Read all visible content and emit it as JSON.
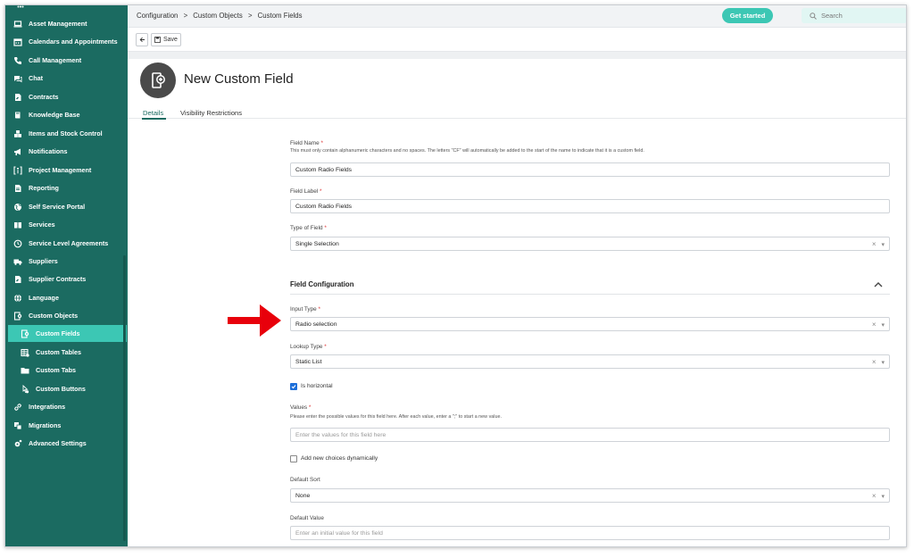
{
  "sidebar": {
    "items": [
      {
        "label": "Asset Management",
        "icon": "laptop-icon"
      },
      {
        "label": "Calendars and Appointments",
        "icon": "calendar-icon"
      },
      {
        "label": "Call Management",
        "icon": "phone-icon"
      },
      {
        "label": "Chat",
        "icon": "chat-icon"
      },
      {
        "label": "Contracts",
        "icon": "contract-icon"
      },
      {
        "label": "Knowledge Base",
        "icon": "book-icon"
      },
      {
        "label": "Items and Stock Control",
        "icon": "boxes-icon"
      },
      {
        "label": "Notifications",
        "icon": "megaphone-icon"
      },
      {
        "label": "Project Management",
        "icon": "project-icon"
      },
      {
        "label": "Reporting",
        "icon": "report-icon"
      },
      {
        "label": "Self Service Portal",
        "icon": "globe-icon"
      },
      {
        "label": "Services",
        "icon": "services-icon"
      },
      {
        "label": "Service Level Agreements",
        "icon": "clock-icon"
      },
      {
        "label": "Suppliers",
        "icon": "truck-icon"
      },
      {
        "label": "Supplier Contracts",
        "icon": "contract-icon"
      },
      {
        "label": "Language",
        "icon": "language-icon"
      },
      {
        "label": "Custom Objects",
        "icon": "custom-objects-icon"
      },
      {
        "label": "Custom Fields",
        "icon": "custom-field-icon",
        "active": true
      },
      {
        "label": "Custom Tables",
        "icon": "table-icon"
      },
      {
        "label": "Custom Tabs",
        "icon": "folder-icon"
      },
      {
        "label": "Custom Buttons",
        "icon": "button-icon"
      },
      {
        "label": "Integrations",
        "icon": "link-icon"
      },
      {
        "label": "Migrations",
        "icon": "migration-icon"
      },
      {
        "label": "Advanced Settings",
        "icon": "gear-icon"
      }
    ]
  },
  "header": {
    "breadcrumb": [
      "Configuration",
      ">",
      "Custom Objects",
      ">",
      "Custom Fields"
    ],
    "get_started": "Get started",
    "search_placeholder": "Search"
  },
  "toolbar": {
    "save_label": "Save"
  },
  "page": {
    "title": "New Custom Field",
    "tabs": [
      "Details",
      "Visibility Restrictions"
    ]
  },
  "form": {
    "field_name": {
      "label": "Field Name",
      "required": "*",
      "hint": "This must only contain alphanumeric characters and no spaces. The letters \"CF\" will automatically be added to the start of the name to indicate that it is a custom field.",
      "value": "Custom Radio Fields"
    },
    "field_label": {
      "label": "Field Label",
      "required": "*",
      "value": "Custom Radio Fields"
    },
    "type_of_field": {
      "label": "Type of Field",
      "required": "*",
      "value": "Single Selection"
    },
    "section_title": "Field Configuration",
    "input_type": {
      "label": "Input Type",
      "required": "*",
      "value": "Radio selection"
    },
    "lookup_type": {
      "label": "Lookup Type",
      "required": "*",
      "value": "Static List"
    },
    "is_horizontal": {
      "label": "Is horizontal",
      "checked": true
    },
    "values": {
      "label": "Values",
      "required": "*",
      "hint": "Please enter the possible values for this field here. After each value, enter a \";\" to start a new value.",
      "placeholder": "Enter the values for this field here"
    },
    "add_new_choices": {
      "label": "Add new choices dynamically",
      "checked": false
    },
    "default_sort": {
      "label": "Default Sort",
      "value": "None"
    },
    "default_value": {
      "label": "Default Value",
      "placeholder": "Enter an initial value for this field"
    },
    "clear_glyph": "×",
    "caret_glyph": "▾"
  },
  "colors": {
    "sidebar_bg": "#1b6b61",
    "accent": "#3cc7b4",
    "annotation_arrow": "#e8000b"
  }
}
